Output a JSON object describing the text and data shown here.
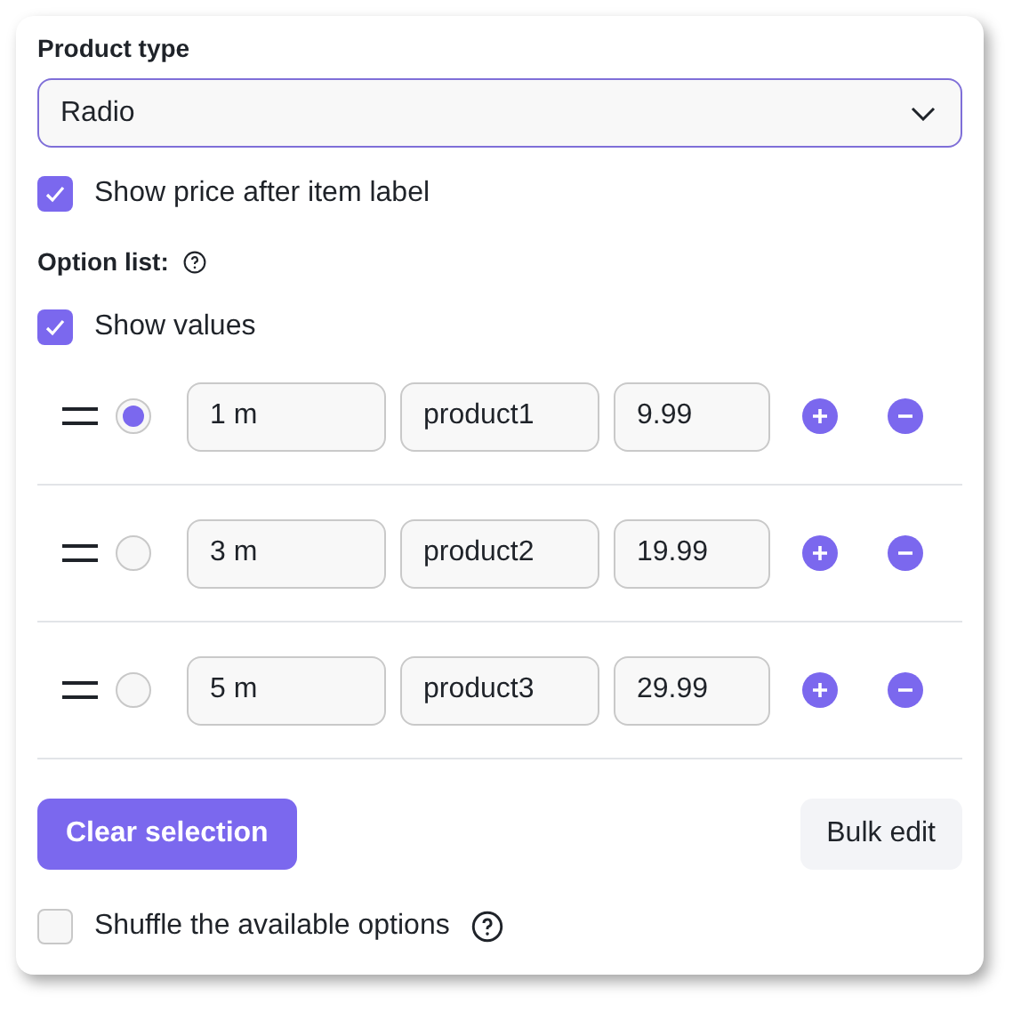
{
  "product_type": {
    "label": "Product type",
    "value": "Radio"
  },
  "show_price": {
    "label": "Show price after item label",
    "checked": true
  },
  "option_list": {
    "label": "Option list:"
  },
  "show_values": {
    "label": "Show values",
    "checked": true
  },
  "options": [
    {
      "label": "1 m",
      "value": "product1",
      "price": "9.99",
      "selected": true
    },
    {
      "label": "3 m",
      "value": "product2",
      "price": "19.99",
      "selected": false
    },
    {
      "label": "5 m",
      "value": "product3",
      "price": "29.99",
      "selected": false
    }
  ],
  "buttons": {
    "clear": "Clear selection",
    "bulk": "Bulk edit"
  },
  "shuffle": {
    "label": "Shuffle the available options",
    "checked": false
  }
}
